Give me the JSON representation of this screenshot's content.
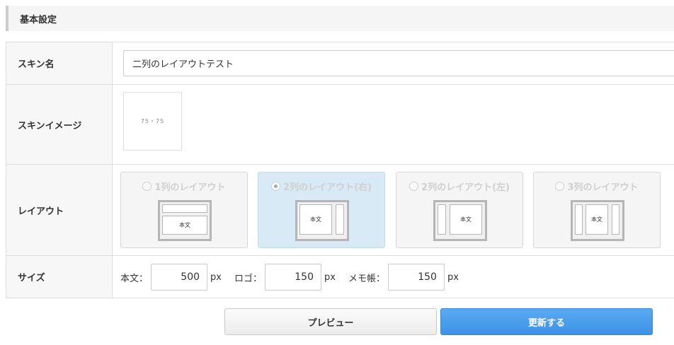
{
  "section": {
    "title": "基本設定"
  },
  "fields": {
    "skin_name": {
      "label": "スキン名",
      "value": "二列のレイアウトテスト"
    },
    "skin_image": {
      "label": "スキンイメージ",
      "thumb_text": "75・75"
    },
    "layout": {
      "label": "レイアウト",
      "selected_index": 1,
      "options": [
        {
          "label": "1列のレイアウト",
          "body_text": "本文"
        },
        {
          "label": "2列のレイアウト(右)",
          "body_text": "本文"
        },
        {
          "label": "2列のレイアウト(左)",
          "body_text": "本文"
        },
        {
          "label": "3列のレイアウト",
          "body_text": "本文"
        }
      ]
    },
    "size": {
      "label": "サイズ",
      "body": {
        "label": "本文：",
        "value": "500",
        "unit": "px"
      },
      "logo": {
        "label": "ロゴ：",
        "value": "150",
        "unit": "px"
      },
      "memo": {
        "label": "メモ帳：",
        "value": "150",
        "unit": "px"
      }
    }
  },
  "buttons": {
    "preview": "プレビュー",
    "update": "更新する"
  },
  "colors": {
    "primary_button": "#4a9eee",
    "selected_card": "#d7eaf5",
    "header_bg": "#f5f5f5"
  }
}
